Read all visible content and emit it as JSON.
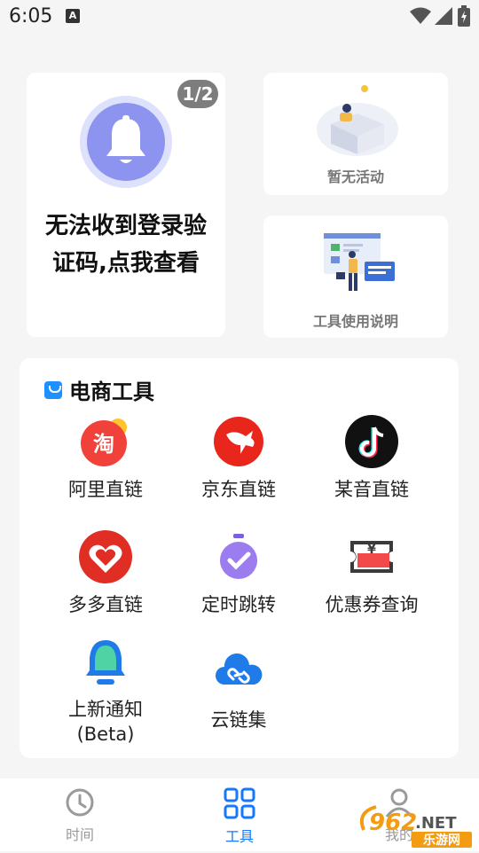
{
  "status_bar": {
    "time": "6:05",
    "notification": "A"
  },
  "bell_card": {
    "badge": "1/2",
    "title": "无法收到登录验\n证码,点我查看"
  },
  "activity_card": {
    "label": "暂无活动"
  },
  "guide_card": {
    "label": "工具使用说明"
  },
  "ecommerce": {
    "heading": "电商工具",
    "tools": [
      {
        "label": "阿里直链",
        "icon": "taobao-icon"
      },
      {
        "label": "京东直链",
        "icon": "jd-icon"
      },
      {
        "label": "某音直链",
        "icon": "douyin-icon"
      },
      {
        "label": "多多直链",
        "icon": "pinduoduo-icon"
      },
      {
        "label": "定时跳转",
        "icon": "timer-icon"
      },
      {
        "label": "优惠券查询",
        "icon": "coupon-icon"
      },
      {
        "label": "上新通知\n(Beta)",
        "icon": "bell-notify-icon"
      },
      {
        "label": "云链集",
        "icon": "cloud-link-icon"
      }
    ]
  },
  "tabbar": {
    "tabs": [
      {
        "label": "时间",
        "active": false
      },
      {
        "label": "工具",
        "active": true
      },
      {
        "label": "我的",
        "active": false
      }
    ]
  },
  "watermark": {
    "brand": "962.NET",
    "sub": "乐游网"
  },
  "colors": {
    "accent": "#1677ff",
    "tab_inactive": "#9a9a9a"
  }
}
